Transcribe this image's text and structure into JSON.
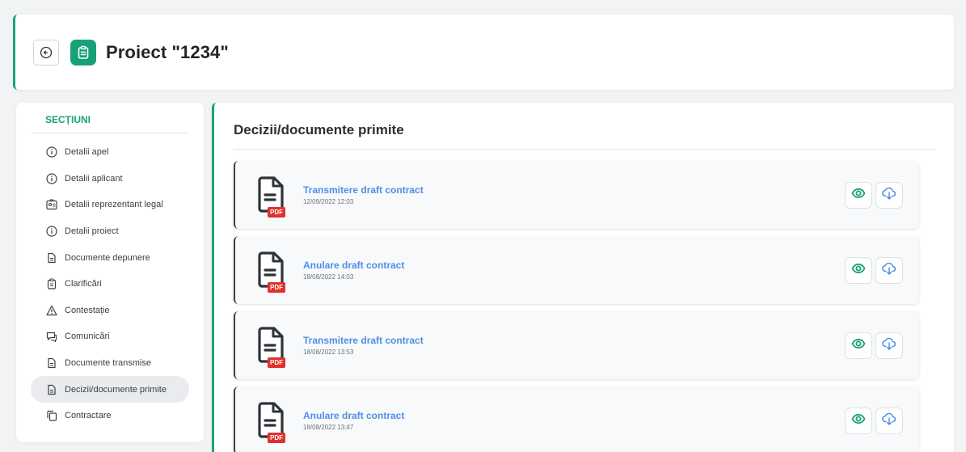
{
  "header": {
    "title": "Proiect \"1234\""
  },
  "sidebar": {
    "section_title": "SECȚIUNI",
    "items": [
      {
        "label": "Detalii apel",
        "icon": "info-icon"
      },
      {
        "label": "Detalii aplicant",
        "icon": "info-icon"
      },
      {
        "label": "Detalii reprezentant legal",
        "icon": "id-card-icon"
      },
      {
        "label": "Detalii proiect",
        "icon": "info-icon"
      },
      {
        "label": "Documente depunere",
        "icon": "document-icon"
      },
      {
        "label": "Clarificări",
        "icon": "clipboard-icon"
      },
      {
        "label": "Contestație",
        "icon": "warning-icon"
      },
      {
        "label": "Comunicări",
        "icon": "chat-icon"
      },
      {
        "label": "Documente transmise",
        "icon": "document-icon"
      },
      {
        "label": "Decizii/documente primite",
        "icon": "document-icon",
        "active": true
      },
      {
        "label": "Contractare",
        "icon": "copy-icon"
      }
    ]
  },
  "main": {
    "title": "Decizii/documente primite",
    "pdf_badge": "PDF",
    "documents": [
      {
        "name": "Transmitere draft contract",
        "date": "12/09/2022 12:03"
      },
      {
        "name": "Anulare draft contract",
        "date": "18/08/2022 14:03"
      },
      {
        "name": "Transmitere draft contract",
        "date": "18/08/2022 13:53"
      },
      {
        "name": "Anulare draft contract",
        "date": "18/08/2022 13:47"
      }
    ]
  },
  "colors": {
    "accent": "#18a079",
    "link": "#4f8fe3",
    "pdf": "#e0312d"
  }
}
